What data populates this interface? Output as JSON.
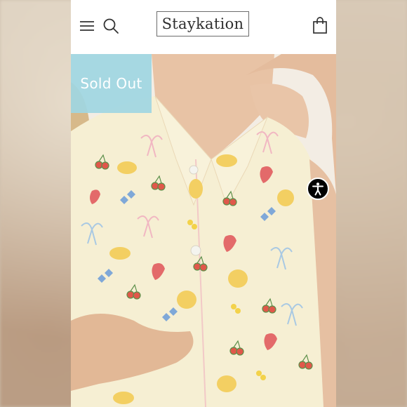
{
  "header": {
    "brand": "Staykation",
    "menu_icon": "hamburger-menu-icon",
    "search_icon": "search-icon",
    "cart_icon": "shopping-bag-icon"
  },
  "product_image": {
    "badge": "Sold Out",
    "badge_color": "#a0d6e2",
    "fabric_color": "#f6efd3"
  },
  "accessibility_widget": {
    "icon": "accessibility-person-icon",
    "background": "#000000"
  }
}
